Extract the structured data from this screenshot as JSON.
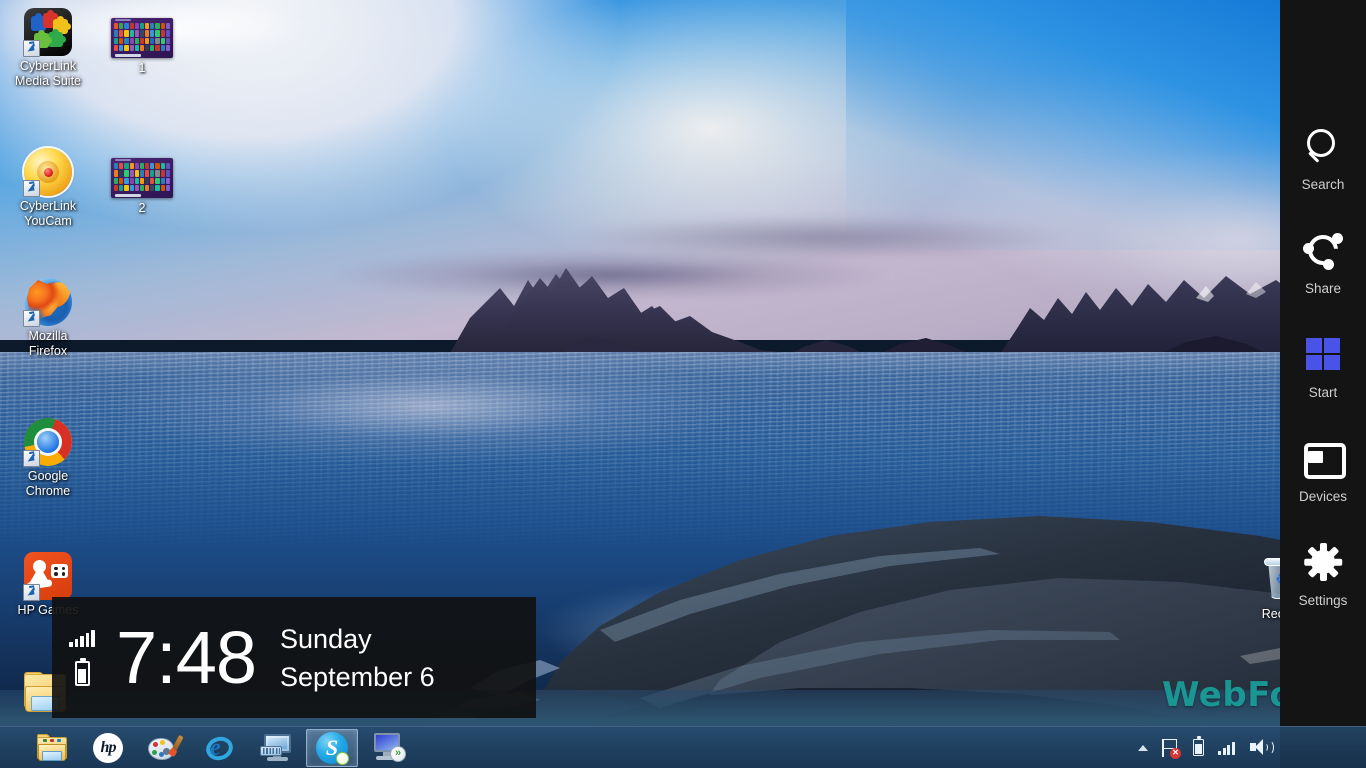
{
  "desktop": {
    "icons": [
      {
        "name": "CyberLink Media Suite",
        "label_line1": "CyberLink",
        "label_line2": "Media Suite",
        "icon": "cyberlink-media-suite-icon"
      },
      {
        "name": "1",
        "label_line1": "1",
        "label_line2": "",
        "icon": "windows8-start-thumbnail-icon"
      },
      {
        "name": "CyberLink YouCam",
        "label_line1": "CyberLink",
        "label_line2": "YouCam",
        "icon": "cyberlink-youcam-icon"
      },
      {
        "name": "2",
        "label_line1": "2",
        "label_line2": "",
        "icon": "windows8-start-thumbnail-icon"
      },
      {
        "name": "Mozilla Firefox",
        "label_line1": "Mozilla",
        "label_line2": "Firefox",
        "icon": "firefox-icon"
      },
      {
        "name": "Google Chrome",
        "label_line1": "Google",
        "label_line2": "Chrome",
        "icon": "chrome-icon"
      },
      {
        "name": "HP Games",
        "label_line1": "HP Games",
        "label_line2": "",
        "icon": "hp-games-icon"
      },
      {
        "name": "Recycle Bin",
        "label_line1": "Recycle",
        "label_line2": "",
        "icon": "recycle-bin-icon"
      },
      {
        "name": "Folder",
        "label_line1": "",
        "label_line2": "",
        "icon": "folder-icon"
      }
    ]
  },
  "clock_panel": {
    "time": "7:48",
    "day": "Sunday",
    "date": "September 6",
    "signal_icon": "signal-bars-icon",
    "battery_icon": "battery-icon"
  },
  "charms": {
    "items": [
      {
        "label": "Search",
        "icon": "search-icon"
      },
      {
        "label": "Share",
        "icon": "share-icon"
      },
      {
        "label": "Start",
        "icon": "windows-start-icon"
      },
      {
        "label": "Devices",
        "icon": "devices-icon"
      },
      {
        "label": "Settings",
        "icon": "gear-icon"
      }
    ],
    "start_accent": "#4a53e8",
    "background": "#141414"
  },
  "taskbar": {
    "buttons": [
      {
        "name": "File Explorer",
        "icon": "file-explorer-icon",
        "active": false
      },
      {
        "name": "HP",
        "icon": "hp-logo-icon",
        "active": false,
        "text": "hp"
      },
      {
        "name": "Paint",
        "icon": "paint-palette-icon",
        "active": false
      },
      {
        "name": "Internet Explorer",
        "icon": "internet-explorer-icon",
        "active": false,
        "text": "e"
      },
      {
        "name": "On-Screen Keyboard",
        "icon": "monitor-keyboard-icon",
        "active": false
      },
      {
        "name": "Skype",
        "icon": "skype-icon",
        "active": true,
        "text": "S"
      },
      {
        "name": "Remote Desktop Connection",
        "icon": "remote-desktop-icon",
        "active": false,
        "text": "»"
      }
    ],
    "tray": [
      {
        "name": "Show hidden icons",
        "icon": "chevron-up-icon"
      },
      {
        "name": "Action Center",
        "icon": "flag-error-icon"
      },
      {
        "name": "Battery",
        "icon": "battery-icon"
      },
      {
        "name": "Network",
        "icon": "signal-bars-icon"
      },
      {
        "name": "Volume",
        "icon": "speaker-icon"
      }
    ]
  },
  "watermark": {
    "text": "WebForPC",
    "color": "#1aa09b"
  }
}
